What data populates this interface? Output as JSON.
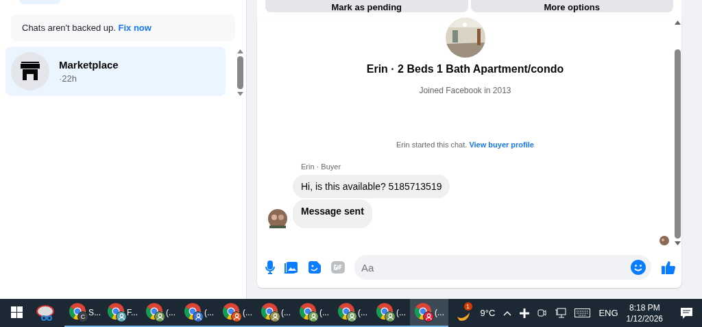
{
  "sidebar": {
    "backup_notice": {
      "text": "Chats aren't backed up.",
      "link": "Fix now"
    },
    "chats": [
      {
        "name": "Marketplace",
        "time": "·22h",
        "selected": true
      }
    ]
  },
  "chat": {
    "actions": [
      "Mark as pending",
      "More options"
    ],
    "header": {
      "title": "Erin · 2 Beds 1 Bath Apartment/condo",
      "subtitle": "Joined Facebook in 2013"
    },
    "system_message": {
      "text": "Erin started this chat.",
      "link": "View buyer profile"
    },
    "sender_label": "Erin · Buyer",
    "messages": [
      {
        "text": "Hi, is this available? 5185713519",
        "bold": false
      },
      {
        "text": "Message sent",
        "bold": true
      }
    ],
    "composer": {
      "placeholder": "Aa"
    }
  },
  "taskbar": {
    "apps": [
      {
        "kind": "snip",
        "selected": false
      },
      {
        "kind": "chrome",
        "label": "S...",
        "badge": "C",
        "color": "#3c4043",
        "selected": false
      },
      {
        "kind": "chrome",
        "label": "F...",
        "color": "#5aa7b3",
        "selected": false
      },
      {
        "kind": "chrome",
        "label": "(...",
        "color": "#6c9a5a",
        "selected": false
      },
      {
        "kind": "chrome",
        "label": "(...",
        "color": "#3b6fd4",
        "selected": false
      },
      {
        "kind": "chrome",
        "label": "(...",
        "color": "#e0531f",
        "selected": false
      },
      {
        "kind": "chrome",
        "label": "(...",
        "color": "#9a9050",
        "selected": false
      },
      {
        "kind": "chrome",
        "label": "(...",
        "color": "#7aa35a",
        "selected": false
      },
      {
        "kind": "chrome",
        "label": "(...",
        "color": "#7fa86a",
        "selected": false
      },
      {
        "kind": "chrome",
        "label": "(...",
        "color": "#6c9a5a",
        "selected": false
      },
      {
        "kind": "chrome",
        "label": "(...",
        "color": "#e0203a",
        "selected": true
      }
    ],
    "weather": {
      "badge": "1",
      "temp": "9°C"
    },
    "language": "ENG",
    "time": "8:18 PM",
    "date": "1/12/2026"
  }
}
